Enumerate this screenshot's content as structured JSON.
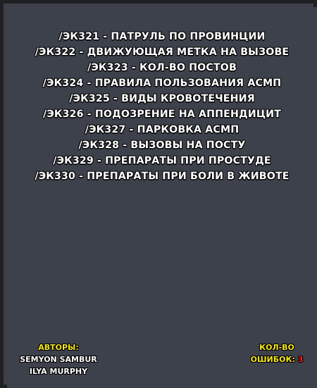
{
  "commands": [
    "/ЭК321 - ПАТРУЛЬ ПО ПРОВИНЦИИ",
    "/ЭК322 - ДВИЖУЮЩАЯ МЕТКА НА ВЫЗОВЕ",
    "/ЭК323 - КОЛ-ВО ПОСТОВ",
    "/ЭК324 - ПРАВИЛА ПОЛЬЗОВАНИЯ АСМП",
    "/ЭК325 - ВИДЫ КРОВОТЕЧЕНИЯ",
    "/ЭК326 - ПОДОЗРЕНИЕ НА АППЕНДИЦИТ",
    "/ЭК327 - ПАРКОВКА АСМП",
    "/ЭК328 - ВЫЗОВЫ НА ПОСТУ",
    "/ЭК329 - ПРЕПАРАТЫ ПРИ ПРОСТУДЕ",
    "/ЭК330 - ПРЕПАРАТЫ ПРИ БОЛИ В ЖИВОТЕ"
  ],
  "authors": {
    "title": "АВТОРЫ:",
    "names": [
      "SEMYON SAMBUR",
      "ILYA MURPHY"
    ]
  },
  "errors": {
    "label_line1": "КОЛ-ВО",
    "label_line2": "ОШИБОК:",
    "count": "3"
  },
  "colors": {
    "background": "#3d414b",
    "text": "#ffffff",
    "accent_yellow": "#f4e61c",
    "accent_red": "#ff2020"
  }
}
